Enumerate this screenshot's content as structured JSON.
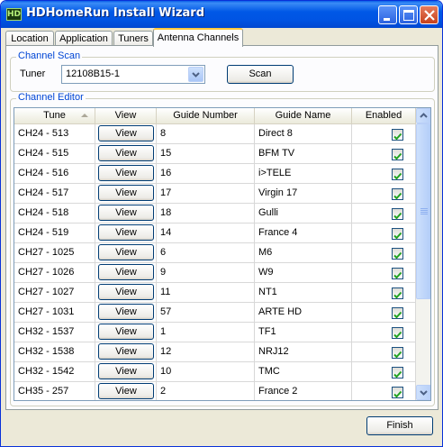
{
  "window": {
    "title": "HDHomeRun Install Wizard",
    "icon": "hd-app-icon",
    "icon_text": "HD"
  },
  "tabs": [
    {
      "label": "Location"
    },
    {
      "label": "Application"
    },
    {
      "label": "Tuners"
    },
    {
      "label": "Antenna Channels",
      "active": true
    }
  ],
  "channel_scan": {
    "legend": "Channel Scan",
    "tuner_label": "Tuner",
    "tuner_value": "12108B15-1",
    "scan_button": "Scan"
  },
  "channel_editor": {
    "legend": "Channel Editor",
    "columns": [
      "Tune",
      "View",
      "Guide Number",
      "Guide Name",
      "Enabled"
    ],
    "rows": [
      {
        "tune": "CH24 - 513",
        "view": "View",
        "guide_number": "8",
        "guide_name": "Direct 8",
        "enabled": true
      },
      {
        "tune": "CH24 - 515",
        "view": "View",
        "guide_number": "15",
        "guide_name": "BFM TV",
        "enabled": true
      },
      {
        "tune": "CH24 - 516",
        "view": "View",
        "guide_number": "16",
        "guide_name": "i>TELE",
        "enabled": true
      },
      {
        "tune": "CH24 - 517",
        "view": "View",
        "guide_number": "17",
        "guide_name": "Virgin 17",
        "enabled": true
      },
      {
        "tune": "CH24 - 518",
        "view": "View",
        "guide_number": "18",
        "guide_name": "Gulli",
        "enabled": true
      },
      {
        "tune": "CH24 - 519",
        "view": "View",
        "guide_number": "14",
        "guide_name": "France 4",
        "enabled": true
      },
      {
        "tune": "CH27 - 1025",
        "view": "View",
        "guide_number": "6",
        "guide_name": "M6",
        "enabled": true
      },
      {
        "tune": "CH27 - 1026",
        "view": "View",
        "guide_number": "9",
        "guide_name": "W9",
        "enabled": true
      },
      {
        "tune": "CH27 - 1027",
        "view": "View",
        "guide_number": "11",
        "guide_name": "NT1",
        "enabled": true
      },
      {
        "tune": "CH27 - 1031",
        "view": "View",
        "guide_number": "57",
        "guide_name": "ARTE HD",
        "enabled": true
      },
      {
        "tune": "CH32 - 1537",
        "view": "View",
        "guide_number": "1",
        "guide_name": "TF1",
        "enabled": true
      },
      {
        "tune": "CH32 - 1538",
        "view": "View",
        "guide_number": "12",
        "guide_name": "NRJ12",
        "enabled": true
      },
      {
        "tune": "CH32 - 1542",
        "view": "View",
        "guide_number": "10",
        "guide_name": "TMC",
        "enabled": true
      },
      {
        "tune": "CH35 - 257",
        "view": "View",
        "guide_number": "2",
        "guide_name": "France 2",
        "enabled": true
      }
    ]
  },
  "footer": {
    "finish_button": "Finish"
  },
  "colors": {
    "titlebar": "#0054e3",
    "check": "#21a121",
    "legend": "#0046d5",
    "face": "#ece9d8"
  }
}
